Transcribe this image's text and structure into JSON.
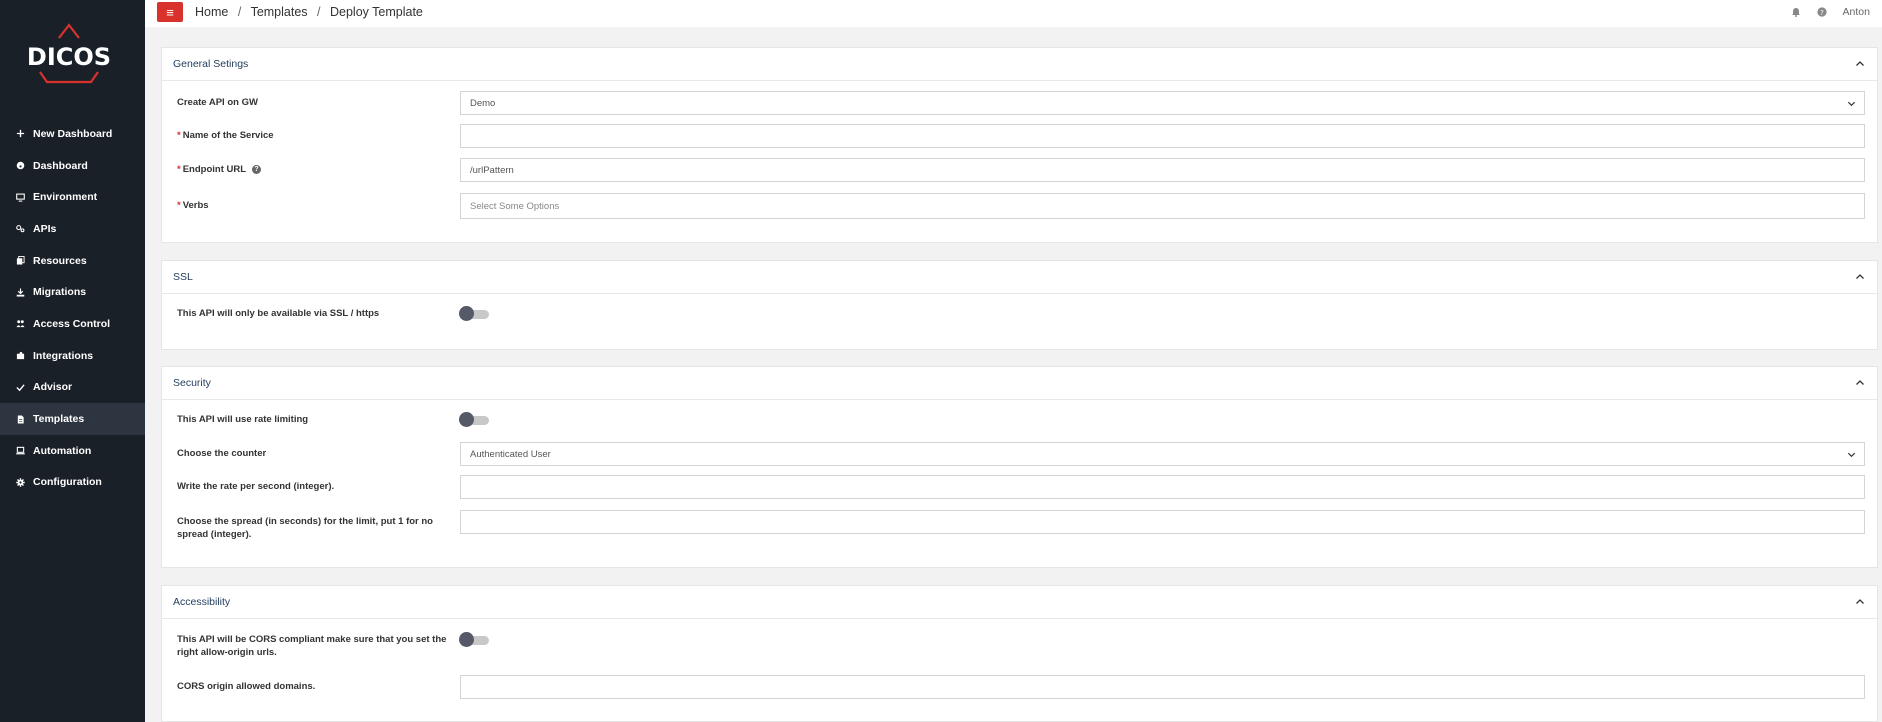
{
  "app": {
    "logo_text": "DICOS"
  },
  "sidebar": {
    "items": [
      {
        "label": "New Dashboard",
        "icon": "plus-icon"
      },
      {
        "label": "Dashboard",
        "icon": "dashboard-icon"
      },
      {
        "label": "Environment",
        "icon": "monitor-icon"
      },
      {
        "label": "APIs",
        "icon": "api-icon"
      },
      {
        "label": "Resources",
        "icon": "resources-icon"
      },
      {
        "label": "Migrations",
        "icon": "migrations-icon"
      },
      {
        "label": "Access Control",
        "icon": "users-icon"
      },
      {
        "label": "Integrations",
        "icon": "puzzle-icon"
      },
      {
        "label": "Advisor",
        "icon": "check-icon"
      },
      {
        "label": "Templates",
        "icon": "file-icon",
        "active": true
      },
      {
        "label": "Automation",
        "icon": "laptop-icon"
      },
      {
        "label": "Configuration",
        "icon": "gear-icon"
      }
    ]
  },
  "topbar": {
    "menu_icon": "≡",
    "breadcrumb": [
      "Home",
      "Templates",
      "Deploy Template"
    ],
    "separator": "/",
    "user": "Anton"
  },
  "general": {
    "title": "General Setings",
    "create_api_label": "Create API on GW",
    "create_api_value": "Demo",
    "service_name_label": "Name of the Service",
    "service_name_value": "",
    "endpoint_label": "Endpoint URL",
    "endpoint_value": "/urlPattern",
    "verbs_label": "Verbs",
    "verbs_placeholder": "Select Some Options",
    "required_mark": "*",
    "help_mark": "?"
  },
  "ssl": {
    "title": "SSL",
    "https_label": "This API will only be available via SSL / https",
    "https_enabled": false
  },
  "security": {
    "title": "Security",
    "rate_limit_label": "This API will use rate limiting",
    "rate_limit_enabled": false,
    "counter_label": "Choose the counter",
    "counter_value": "Authenticated User",
    "rate_label": "Write the rate per second (integer).",
    "rate_value": "",
    "spread_label": "Choose the spread (in seconds) for the limit, put 1 for no spread (integer).",
    "spread_value": ""
  },
  "accessibility": {
    "title": "Accessibility",
    "cors_label": "This API will be CORS compliant make sure that you set the right allow-origin urls.",
    "cors_enabled": false,
    "cors_domains_label": "CORS origin allowed domains.",
    "cors_domains_value": ""
  },
  "colors": {
    "sidebar_bg": "#1a2028",
    "accent_red": "#d9322c",
    "panel_title": "#1f3b5c"
  }
}
